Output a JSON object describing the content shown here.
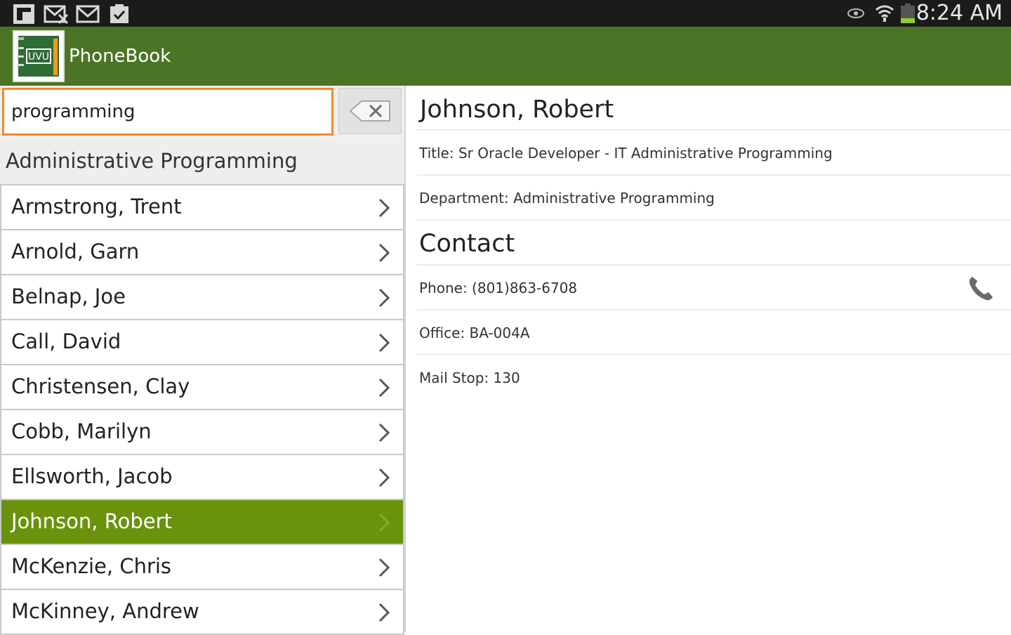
{
  "status_bar": {
    "time": "8:24 AM",
    "icons": [
      "flipboard-icon",
      "mail-x-icon",
      "gmail-icon",
      "clipboard-check-icon",
      "eye-icon",
      "wifi-icon",
      "battery-icon"
    ]
  },
  "action_bar": {
    "title": "PhoneBook",
    "logo_text": "UVU"
  },
  "search": {
    "value": "programming",
    "clear_icon": "clear-backspace-icon"
  },
  "section_header": "Administrative Programming",
  "people": [
    {
      "name": "Armstrong, Trent",
      "selected": false
    },
    {
      "name": "Arnold, Garn",
      "selected": false
    },
    {
      "name": "Belnap, Joe",
      "selected": false
    },
    {
      "name": "Call, David",
      "selected": false
    },
    {
      "name": "Christensen, Clay",
      "selected": false
    },
    {
      "name": "Cobb, Marilyn",
      "selected": false
    },
    {
      "name": "Ellsworth, Jacob",
      "selected": false
    },
    {
      "name": "Johnson, Robert",
      "selected": true
    },
    {
      "name": "McKenzie, Chris",
      "selected": false
    },
    {
      "name": "McKinney, Andrew",
      "selected": false
    }
  ],
  "detail": {
    "name": "Johnson, Robert",
    "title_line": "Title: Sr Oracle Developer - IT Administrative Programming",
    "department_line": "Department: Administrative Programming",
    "contact_heading": "Contact",
    "phone_line": "Phone: (801)863-6708",
    "office_line": "Office: BA-004A",
    "mailstop_line": "Mail Stop: 130"
  },
  "colors": {
    "action_bar": "#4b7524",
    "selected_row": "#6b920c",
    "search_focus": "#f08a24",
    "status_bar": "#1b1b1b"
  }
}
